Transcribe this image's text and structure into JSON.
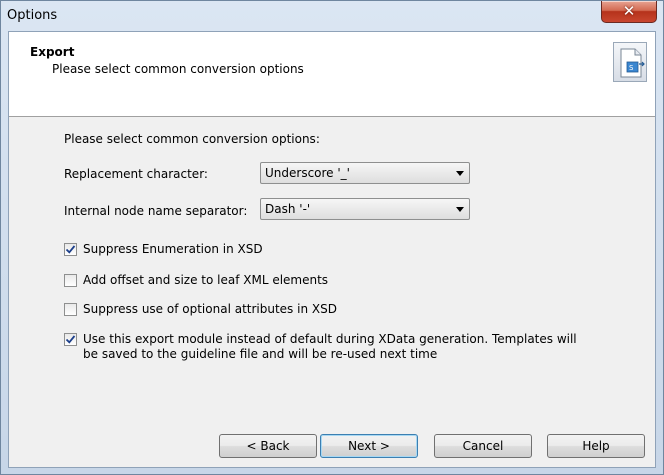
{
  "window": {
    "title": "Options",
    "close_symbol": "✕"
  },
  "header": {
    "title": "Export",
    "subtitle": "Please select common conversion options",
    "icon": "export-document-icon"
  },
  "content": {
    "intro": "Please select common conversion options:",
    "replacement": {
      "label": "Replacement character:",
      "value": "Underscore '_'"
    },
    "separator": {
      "label": "Internal node name separator:",
      "value": "Dash '-'"
    },
    "options": [
      {
        "label": "Suppress Enumeration in XSD",
        "checked": true
      },
      {
        "label": "Add offset and size to leaf XML elements",
        "checked": false
      },
      {
        "label": "Suppress use of optional attributes in XSD",
        "checked": false
      },
      {
        "label": "Use this export module instead of default during XData generation. Templates will be saved to the guideline file and will be re-used next time",
        "checked": true
      }
    ]
  },
  "buttons": {
    "back": "< Back",
    "next": "Next >",
    "cancel": "Cancel",
    "help": "Help"
  }
}
